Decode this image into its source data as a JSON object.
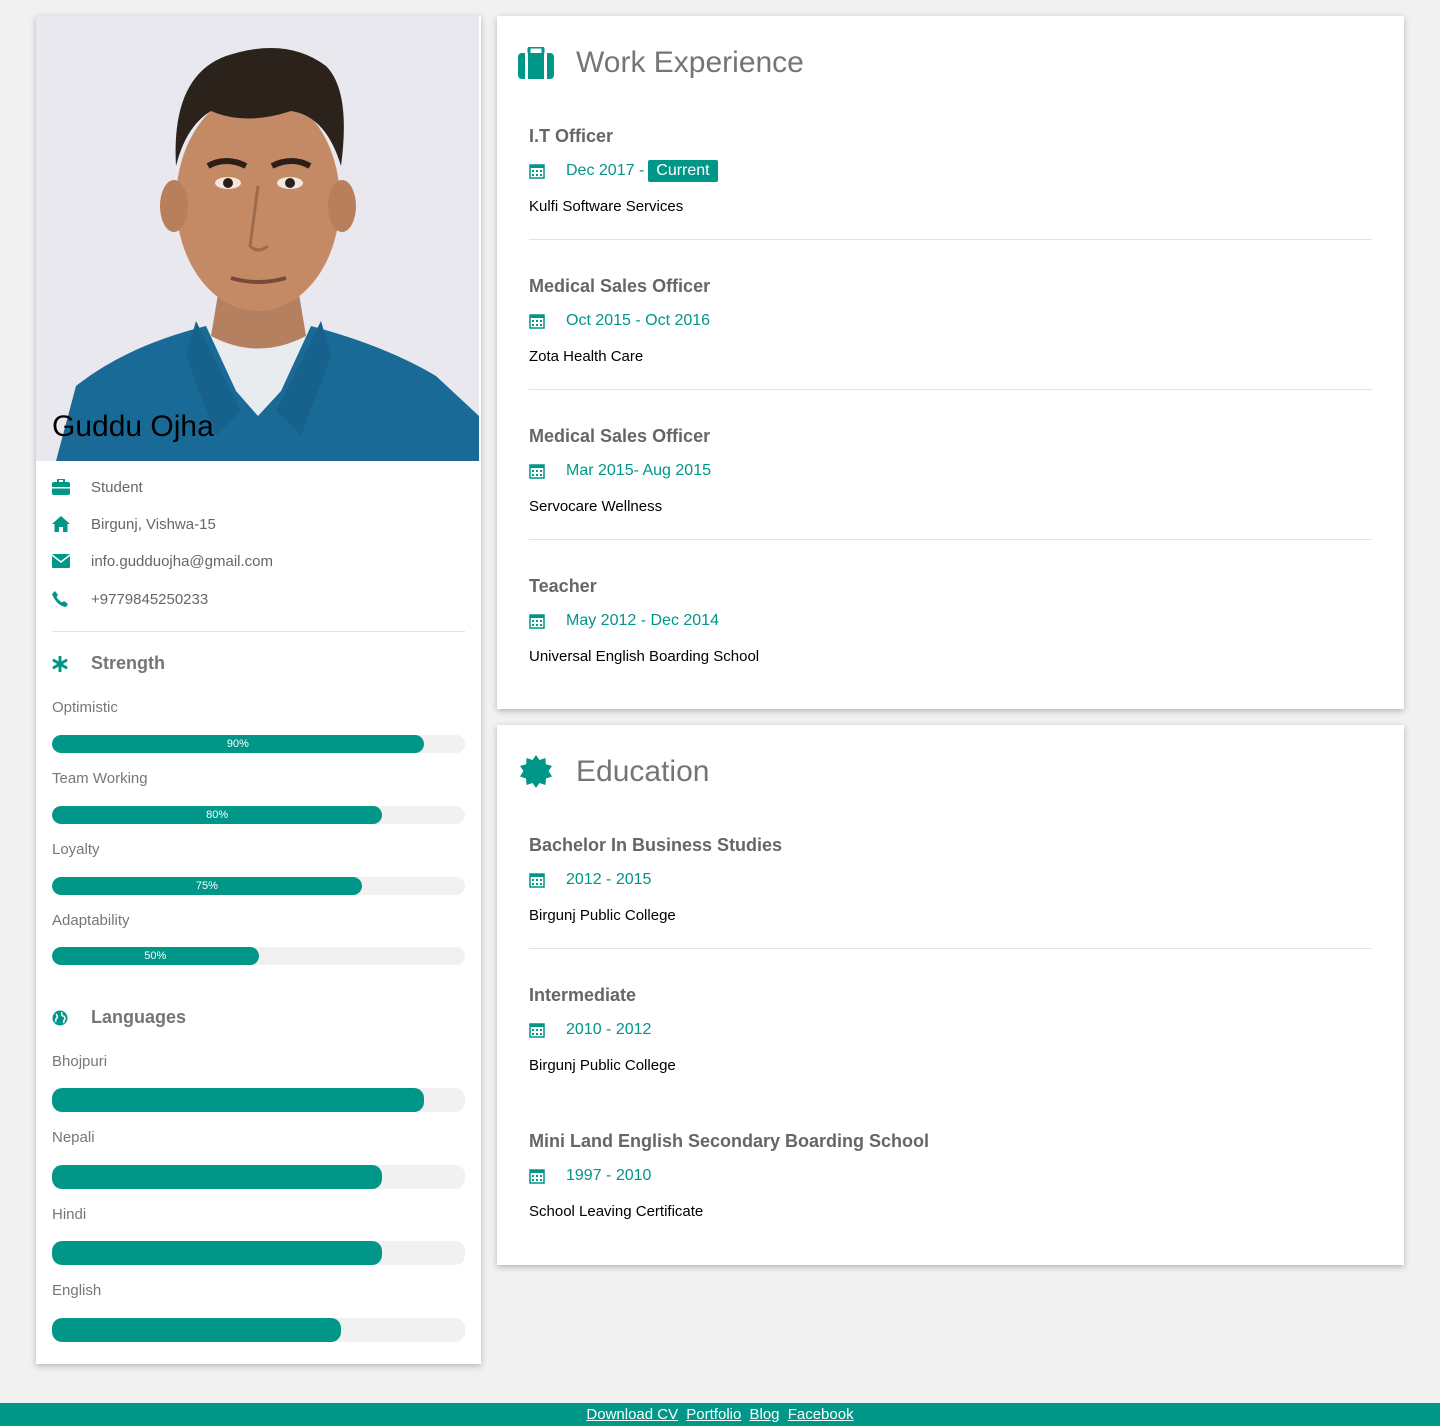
{
  "profile": {
    "name": "Guddu Ojha",
    "occupation": "Student",
    "address": "Birgunj, Vishwa-15",
    "email": "info.gudduojha@gmail.com",
    "phone": "+9779845250233"
  },
  "strength": {
    "title": "Strength",
    "items": [
      {
        "label": "Optimistic",
        "percent": 90,
        "percent_label": "90%"
      },
      {
        "label": "Team Working",
        "percent": 80,
        "percent_label": "80%"
      },
      {
        "label": "Loyalty",
        "percent": 75,
        "percent_label": "75%"
      },
      {
        "label": "Adaptability",
        "percent": 50,
        "percent_label": "50%"
      }
    ]
  },
  "languages": {
    "title": "Languages",
    "items": [
      {
        "label": "Bhojpuri",
        "percent": 90
      },
      {
        "label": "Nepali",
        "percent": 80
      },
      {
        "label": "Hindi",
        "percent": 80
      },
      {
        "label": "English",
        "percent": 70
      }
    ]
  },
  "work": {
    "title": "Work Experience",
    "entries": [
      {
        "role": "I.T Officer",
        "date": "Dec 2017 -",
        "tag": "Current",
        "org": "Kulfi Software Services"
      },
      {
        "role": "Medical Sales Officer",
        "date": "Oct 2015 - Oct 2016",
        "org": "Zota Health Care"
      },
      {
        "role": "Medical Sales Officer",
        "date": "Mar 2015- Aug 2015",
        "org": "Servocare Wellness"
      },
      {
        "role": "Teacher",
        "date": "May 2012 - Dec 2014",
        "org": "Universal English Boarding School"
      }
    ]
  },
  "education": {
    "title": "Education",
    "entries": [
      {
        "role": "Bachelor In Business Studies",
        "date": "2012 - 2015",
        "org": "Birgunj Public College"
      },
      {
        "role": "Intermediate",
        "date": "2010 - 2012",
        "org": "Birgunj Public College"
      },
      {
        "role": "Mini Land English Secondary Boarding School",
        "date": "1997 - 2010",
        "org": "School Leaving Certificate"
      }
    ]
  },
  "footer": {
    "links": [
      "Download CV",
      "Portfolio",
      "Blog",
      "Facebook"
    ]
  },
  "colors": {
    "accent": "#009688",
    "background": "#f1f1f1",
    "text": "#757575"
  }
}
